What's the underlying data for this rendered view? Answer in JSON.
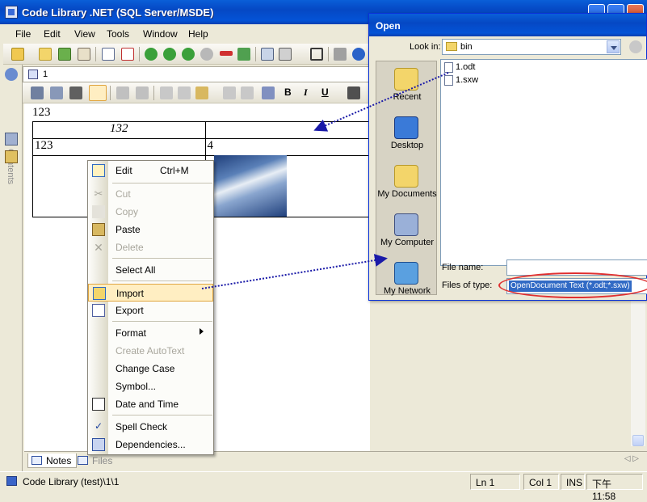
{
  "window": {
    "title": "Code Library .NET (SQL Server/MSDE)"
  },
  "menu": [
    {
      "label": "File",
      "key": "F"
    },
    {
      "label": "Edit",
      "key": "E"
    },
    {
      "label": "View",
      "key": "V"
    },
    {
      "label": "Tools",
      "key": "T"
    },
    {
      "label": "Window",
      "key": "W"
    },
    {
      "label": "Help",
      "key": "H"
    }
  ],
  "sidebar": {
    "contents_label": "Contents"
  },
  "document": {
    "page_number": "1",
    "line1": "123",
    "table": [
      [
        "132",
        ""
      ],
      [
        "123",
        "4"
      ]
    ]
  },
  "format_toolbar": {
    "bold": "B",
    "italic": "I",
    "underline": "U"
  },
  "context_menu": {
    "edit": "Edit",
    "edit_shortcut": "Ctrl+M",
    "cut": "Cut",
    "copy": "Copy",
    "paste": "Paste",
    "delete": "Delete",
    "select_all": "Select All",
    "import": "Import",
    "export": "Export",
    "format": "Format",
    "create_autotext": "Create AutoText",
    "change_case": "Change Case",
    "symbol": "Symbol...",
    "date_and_time": "Date and Time",
    "spell_check": "Spell Check",
    "dependencies": "Dependencies..."
  },
  "dialog": {
    "title": "Open",
    "look_in_label": "Look in:",
    "look_in_value": "bin",
    "places": [
      "Recent",
      "Desktop",
      "My Documents",
      "My Computer",
      "My Network"
    ],
    "files": [
      "1.odt",
      "1.sxw"
    ],
    "file_name_label": "File name:",
    "file_name_value": "",
    "files_of_type_label": "Files of type:",
    "files_of_type_value": "OpenDocument Text (*.odt;*.sxw)"
  },
  "bottom_tabs": {
    "notes": "Notes",
    "files": "Files"
  },
  "status": {
    "path": "Code Library (test)\\1\\1",
    "line": "Ln 1",
    "col": "Col 1",
    "mode": "INS",
    "time": "下午 11:58"
  },
  "colors": {
    "title_blue": "#0548c4",
    "highlight": "#ffeec2",
    "selection": "#316ac5",
    "callout": "#e03030",
    "arrow": "#1a1aa8"
  }
}
